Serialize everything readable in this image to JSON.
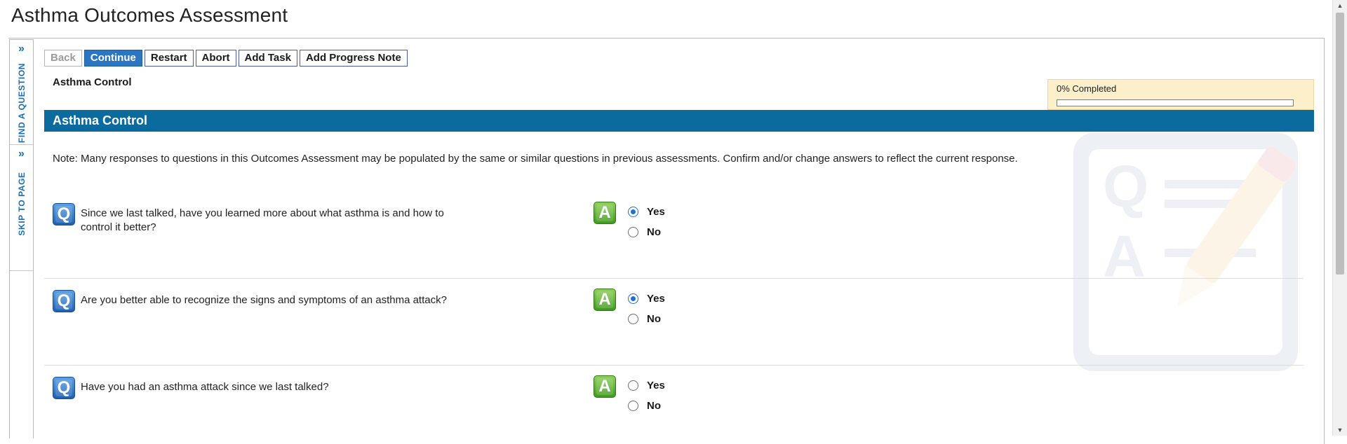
{
  "page": {
    "title": "Asthma Outcomes Assessment"
  },
  "side_tabs": {
    "find_question": "FIND A QUESTION",
    "skip_to_page": "SKIP TO PAGE",
    "chevron": "»"
  },
  "toolbar": {
    "back": "Back",
    "continue": "Continue",
    "restart": "Restart",
    "abort": "Abort",
    "add_task": "Add Task",
    "add_progress_note": "Add Progress Note"
  },
  "section_small_title": "Asthma Control",
  "progress": {
    "label": "0% Completed",
    "percent": 0
  },
  "section_bar_title": "Asthma Control",
  "note": "Note: Many responses to questions in this Outcomes Assessment may be populated by the same or similar questions in previous assessments. Confirm and/or change answers to reflect the current response.",
  "questions": [
    {
      "q_glyph": "Q",
      "a_glyph": "A",
      "text": "Since we last talked, have you learned more about what asthma is and how to control it better?",
      "options": [
        "Yes",
        "No"
      ],
      "selected": "Yes"
    },
    {
      "q_glyph": "Q",
      "a_glyph": "A",
      "text": "Are you better able to recognize the signs and symptoms of an asthma attack?",
      "options": [
        "Yes",
        "No"
      ],
      "selected": "Yes"
    },
    {
      "q_glyph": "Q",
      "a_glyph": "A",
      "text": "Have you had an asthma attack since we last talked?",
      "options": [
        "Yes",
        "No"
      ],
      "selected": null
    }
  ],
  "colors": {
    "accent_blue": "#2a76c2",
    "section_bar": "#0b6b9f",
    "progress_bg": "#fcefc9",
    "answer_green": "#3f9a1e"
  },
  "icons": {
    "question": "q-icon",
    "answer": "a-icon",
    "watermark": "qa-notepad-pencil-icon",
    "chevron": "chevron-double-right-icon"
  }
}
